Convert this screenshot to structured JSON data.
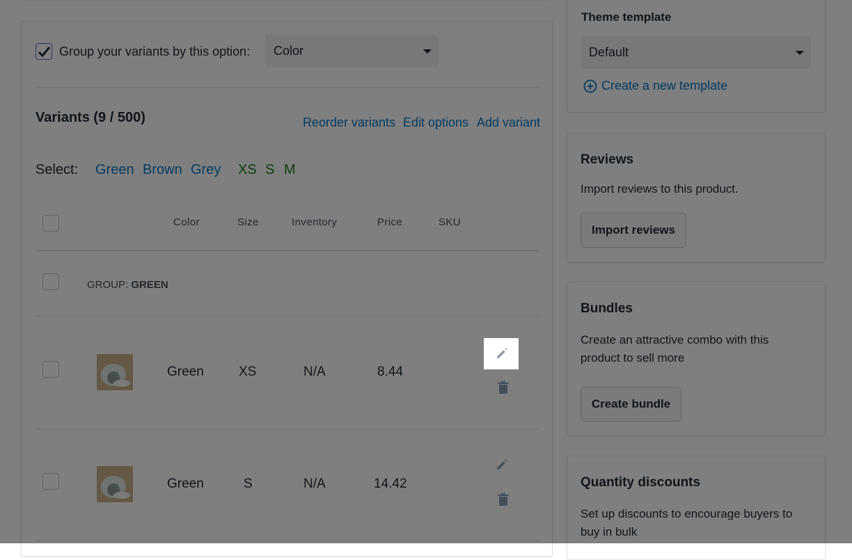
{
  "group_by": {
    "label": "Group your variants by this option:",
    "checked": true,
    "selected": "Color"
  },
  "variants": {
    "title": "Variants (9 / 500)",
    "actions": {
      "reorder": "Reorder variants",
      "edit_options": "Edit options",
      "add_variant": "Add variant"
    },
    "select_label": "Select:",
    "select_colors": [
      "Green",
      "Brown",
      "Grey"
    ],
    "select_sizes": [
      "XS",
      "S",
      "M"
    ],
    "columns": {
      "color": "Color",
      "size": "Size",
      "inventory": "Inventory",
      "price": "Price",
      "sku": "SKU"
    },
    "group": {
      "prefix": "GROUP:",
      "name": "GREEN"
    },
    "rows": [
      {
        "color": "Green",
        "size": "XS",
        "inventory": "N/A",
        "price": "8.44",
        "sku": ""
      },
      {
        "color": "Green",
        "size": "S",
        "inventory": "N/A",
        "price": "14.42",
        "sku": ""
      }
    ]
  },
  "theme": {
    "title": "Theme template",
    "selected": "Default",
    "create_link": "Create a new template"
  },
  "reviews": {
    "title": "Reviews",
    "description": "Import reviews to this product.",
    "button": "Import reviews"
  },
  "bundles": {
    "title": "Bundles",
    "description": "Create an attractive combo with this product to sell more",
    "button": "Create bundle"
  },
  "quantity_discounts": {
    "title": "Quantity discounts",
    "description": "Set up discounts to encourage buyers to buy in bulk"
  }
}
